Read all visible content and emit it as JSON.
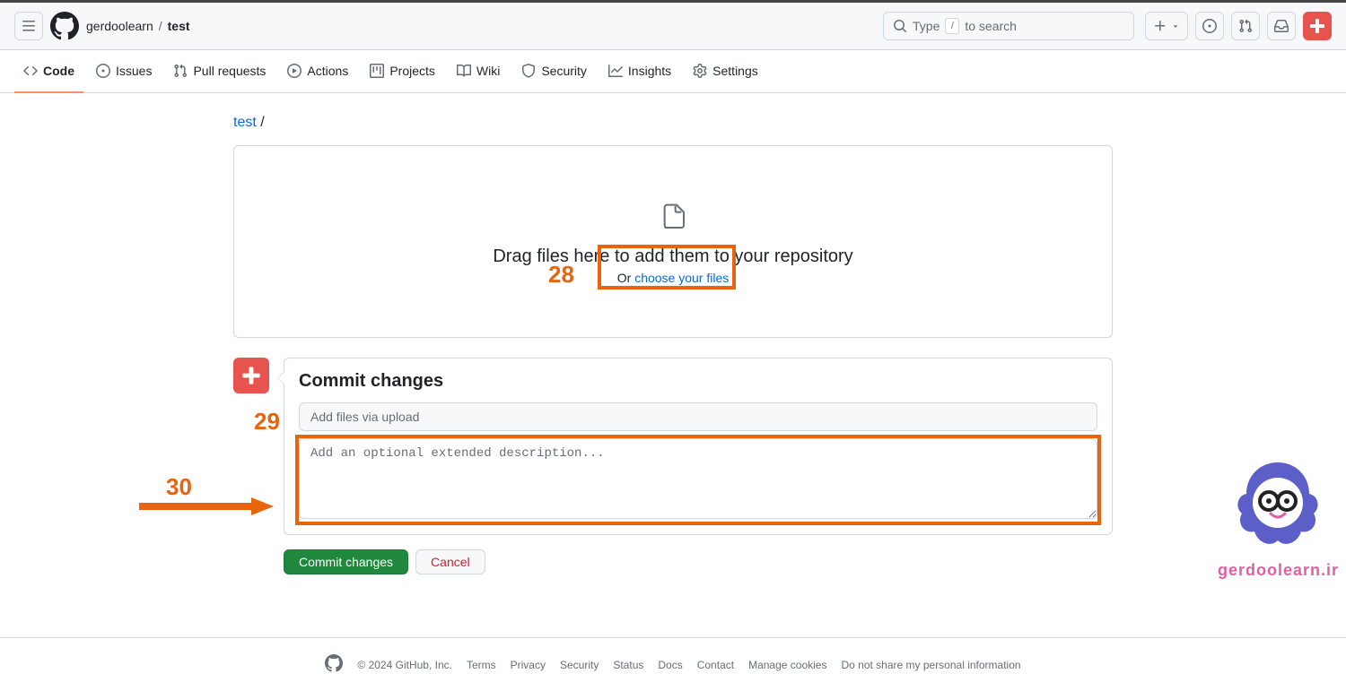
{
  "header": {
    "owner": "gerdoolearn",
    "repo": "test",
    "search_placeholder": "Type / to search",
    "search_kbd": "/"
  },
  "reponav": {
    "code": "Code",
    "issues": "Issues",
    "pull_requests": "Pull requests",
    "actions": "Actions",
    "projects": "Projects",
    "wiki": "Wiki",
    "security": "Security",
    "insights": "Insights",
    "settings": "Settings"
  },
  "breadcrumb": {
    "root": "test",
    "sep": "/"
  },
  "dropzone": {
    "title": "Drag files here to add them to your repository",
    "or": "Or ",
    "link": "choose your files"
  },
  "commit": {
    "heading": "Commit changes",
    "summary_placeholder": "Add files via upload",
    "description_placeholder": "Add an optional extended description...",
    "commit_button": "Commit changes",
    "cancel_button": "Cancel"
  },
  "footer": {
    "copyright": "© 2024 GitHub, Inc.",
    "terms": "Terms",
    "privacy": "Privacy",
    "security": "Security",
    "status": "Status",
    "docs": "Docs",
    "contact": "Contact",
    "cookies": "Manage cookies",
    "no_share": "Do not share my personal information"
  },
  "annotations": {
    "n28": "28",
    "n29": "29",
    "n30": "30"
  },
  "watermark": {
    "text": "gerdoolearn.ir"
  }
}
